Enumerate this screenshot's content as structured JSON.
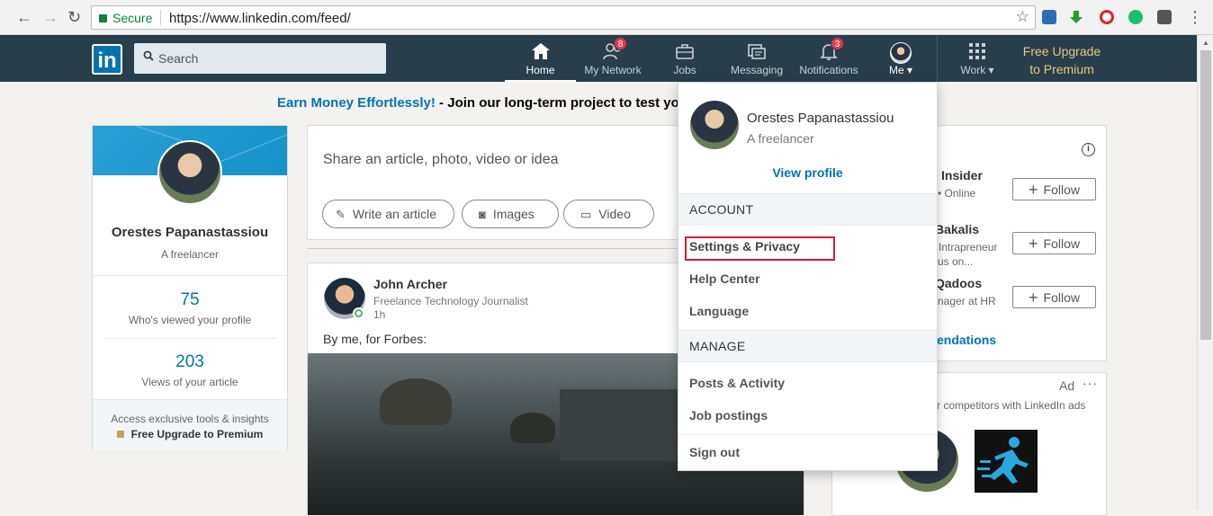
{
  "browser": {
    "secure_label": "Secure",
    "url": "https://www.linkedin.com/feed/",
    "back_icon": "←",
    "forward_icon": "→",
    "reload_icon": "↻",
    "star_icon": "☆",
    "menu_icon": "⋮"
  },
  "navbar": {
    "logo_text": "in",
    "search_placeholder": "Search",
    "items": [
      {
        "label": "Home",
        "icon": "home-icon",
        "glyph": "⌂"
      },
      {
        "label": "My Network",
        "icon": "network-icon",
        "glyph": "⚇",
        "badge": "8"
      },
      {
        "label": "Jobs",
        "icon": "briefcase-icon",
        "glyph": "▣"
      },
      {
        "label": "Messaging",
        "icon": "messaging-icon",
        "glyph": "▤"
      },
      {
        "label": "Notifications",
        "icon": "bell-icon",
        "glyph": "△",
        "badge": "3"
      },
      {
        "label": "Me ▾",
        "icon": "avatar"
      },
      {
        "label": "Work ▾",
        "icon": "grid-icon",
        "glyph": "⁙"
      }
    ],
    "premium_line1": "Free Upgrade",
    "premium_line2": "to Premium"
  },
  "banner": {
    "lead": "Earn Money Effortlessly!",
    "rest": " - Join our long-term project to test yo"
  },
  "profile_card": {
    "name": "Orestes Papanastassiou",
    "headline": "A freelancer",
    "stat1_value": "75",
    "stat1_label": "Who's viewed your profile",
    "stat2_value": "203",
    "stat2_label": "Views of your article",
    "footer_line1": "Access exclusive tools & insights",
    "footer_line2": "Free Upgrade to Premium"
  },
  "share_box": {
    "prompt": "Share an article, photo, video or idea",
    "write_label": "Write an article",
    "images_label": "Images",
    "video_label": "Video",
    "write_glyph": "✎",
    "images_glyph": "◙",
    "video_glyph": "▭"
  },
  "post": {
    "author": "John Archer",
    "headline": "Freelance Technology Journalist",
    "time": "1h",
    "text": "By me, for Forbes:"
  },
  "right_rail": {
    "title_partial": "d",
    "info_glyph": "i",
    "people": [
      {
        "name": "Insider",
        "sub": "• Online"
      },
      {
        "name": "Bakalis",
        "sub": "Intrapreneur",
        "sub2": "us on..."
      },
      {
        "name": "Qadoos",
        "sub": "nager at HR"
      }
    ],
    "follow_label": "Follow",
    "recs_partial": "endations"
  },
  "ad_card": {
    "ad_label": "Ad",
    "dots": "···",
    "text_partial": "r competitors with LinkedIn ads"
  },
  "me_menu": {
    "name": "Orestes Papanastassiou",
    "headline": "A freelancer",
    "view_profile": "View profile",
    "account_header": "ACCOUNT",
    "account_items": [
      "Settings & Privacy",
      "Help Center",
      "Language"
    ],
    "manage_header": "MANAGE",
    "manage_items": [
      "Posts & Activity",
      "Job postings"
    ],
    "sign_out": "Sign out"
  },
  "colors": {
    "nav_bg": "#283e4a",
    "brand_blue": "#0073b1",
    "premium_gold": "#e6c788",
    "highlight_red": "#d0202e",
    "badge_red": "#e0394a"
  }
}
